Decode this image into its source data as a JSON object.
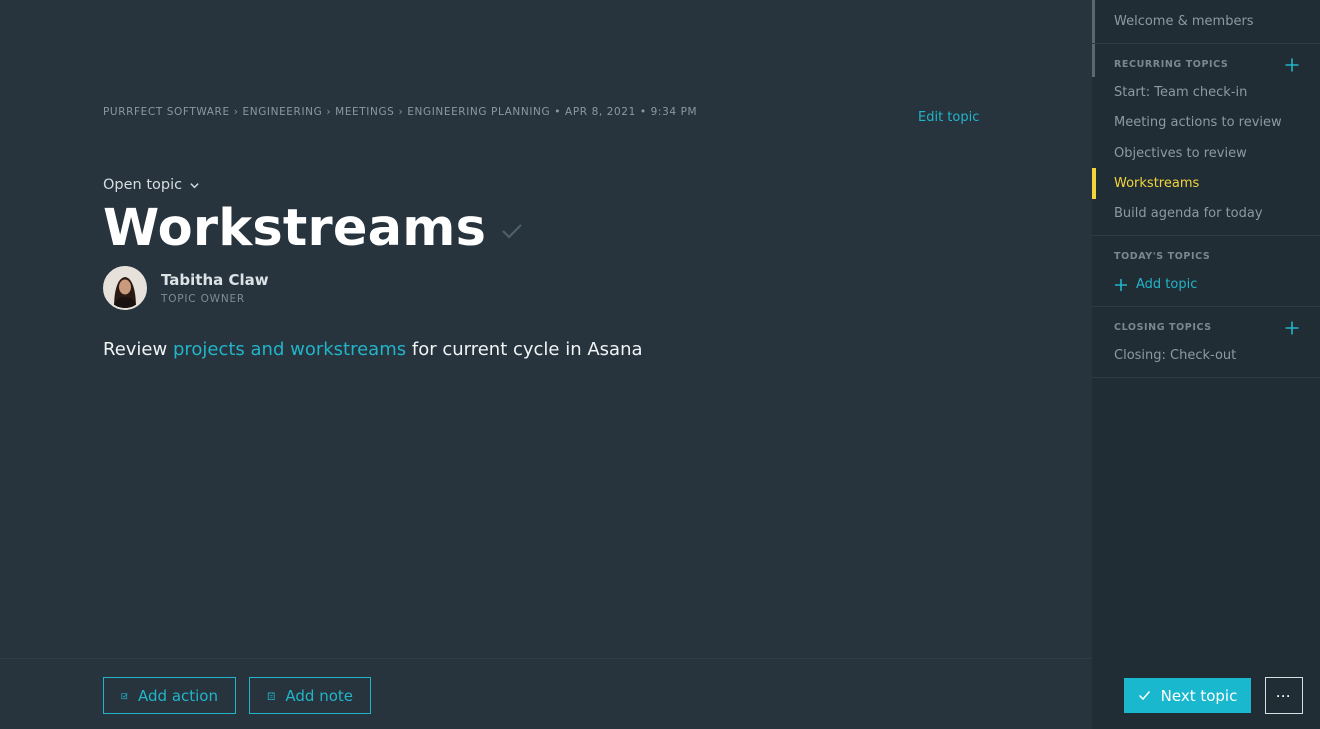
{
  "breadcrumb": {
    "items": [
      "PURRFECT SOFTWARE",
      "ENGINEERING",
      "MEETINGS",
      "ENGINEERING PLANNING"
    ],
    "date": "APR 8, 2021",
    "time": "9:34 PM"
  },
  "header": {
    "edit_label": "Edit topic",
    "open_topic_label": "Open topic",
    "title": "Workstreams"
  },
  "owner": {
    "name": "Tabitha Claw",
    "role": "TOPIC OWNER"
  },
  "description": {
    "prefix": "Review ",
    "link": "projects and workstreams",
    "suffix": " for current cycle in Asana"
  },
  "actions": {
    "add_action": "Add action",
    "add_note": "Add note",
    "next_topic": "Next topic",
    "more": "···"
  },
  "sidebar": {
    "welcome": "Welcome & members",
    "recurring_heading": "RECURRING TOPICS",
    "recurring_items": [
      "Start: Team check-in",
      "Meeting actions to review",
      "Objectives to review",
      "Workstreams",
      "Build agenda for today"
    ],
    "todays_heading": "TODAY'S TOPICS",
    "add_topic": "Add topic",
    "closing_heading": "CLOSING TOPICS",
    "closing_items": [
      "Closing: Check-out"
    ]
  },
  "colors": {
    "accent": "#22b4c8",
    "active": "#f2d43c",
    "main_bg": "#27343d",
    "sidebar_bg": "#212d35"
  }
}
